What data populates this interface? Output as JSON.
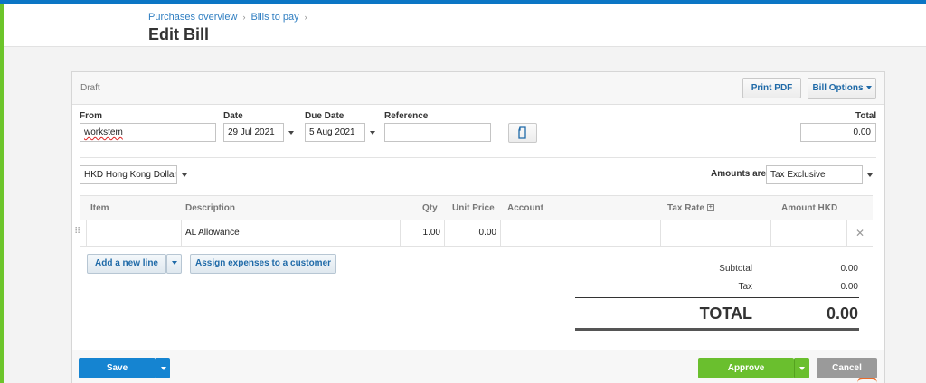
{
  "breadcrumb": {
    "items": [
      "Purchases overview",
      "Bills to pay"
    ]
  },
  "page": {
    "title": "Edit Bill"
  },
  "bill": {
    "status": "Draft",
    "print_pdf": "Print PDF",
    "options": "Bill Options",
    "from_label": "From",
    "from_value": "workstem",
    "date_label": "Date",
    "date_value": "29 Jul 2021",
    "due_label": "Due Date",
    "due_value": "5 Aug 2021",
    "reference_label": "Reference",
    "reference_value": "",
    "total_label": "Total",
    "total_value": "0.00",
    "currency": "HKD Hong Kong Dollar",
    "amounts_label": "Amounts are",
    "amounts_value": "Tax Exclusive"
  },
  "table": {
    "headers": {
      "item": "Item",
      "description": "Description",
      "qty": "Qty",
      "unit_price": "Unit Price",
      "account": "Account",
      "tax_rate": "Tax Rate",
      "amount": "Amount HKD"
    },
    "rows": [
      {
        "item": "",
        "description": "AL Allowance",
        "qty": "1.00",
        "unit_price": "0.00",
        "account": "",
        "tax_rate": "",
        "amount": ""
      }
    ]
  },
  "actions": {
    "add_line": "Add a new line",
    "assign_expenses": "Assign expenses to a customer",
    "save": "Save",
    "approve": "Approve",
    "cancel": "Cancel"
  },
  "totals": {
    "subtotal_label": "Subtotal",
    "subtotal_value": "0.00",
    "tax_label": "Tax",
    "tax_value": "0.00",
    "total_label": "TOTAL",
    "total_value": "0.00"
  },
  "colors": {
    "brand_blue": "#0b76c5",
    "accent_green": "#6cc52a",
    "save_blue": "#1584d1",
    "approve_green": "#6abf2e",
    "cancel_gray": "#9a9a9a"
  }
}
